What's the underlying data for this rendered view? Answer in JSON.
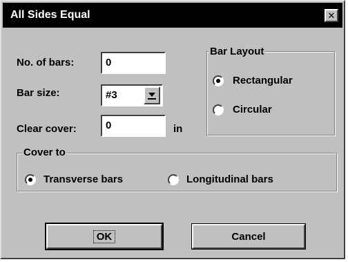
{
  "window": {
    "title": "All Sides Equal",
    "close_glyph": "✕"
  },
  "bars": {
    "no_of_bars_label": "No. of bars:",
    "no_of_bars_value": "0",
    "bar_size_label": "Bar size:",
    "bar_size_value": "#3",
    "clear_cover_label": "Clear cover:",
    "clear_cover_value": "0",
    "clear_cover_unit": "in"
  },
  "bar_layout": {
    "label": "Bar Layout",
    "options": [
      {
        "label": "Rectangular",
        "selected": true
      },
      {
        "label": "Circular",
        "selected": false
      }
    ]
  },
  "cover_to": {
    "label": "Cover to",
    "options": [
      {
        "label": "Transverse bars",
        "selected": true
      },
      {
        "label": "Longitudinal bars",
        "selected": false
      }
    ]
  },
  "buttons": {
    "ok": "OK",
    "cancel": "Cancel"
  },
  "icons": {
    "close": "close-icon",
    "dropdown": "chevron-down-icon"
  }
}
